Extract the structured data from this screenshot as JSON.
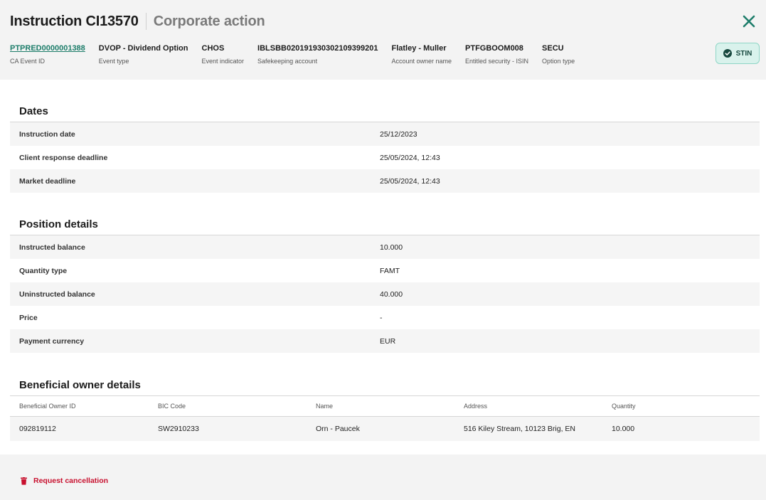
{
  "header": {
    "title": "Instruction CI13570",
    "subtitle": "Corporate action",
    "meta": [
      {
        "value": "PTPRED0000001388",
        "label": "CA Event ID",
        "link": true
      },
      {
        "value": "DVOP - Dividend Option",
        "label": "Event type"
      },
      {
        "value": "CHOS",
        "label": "Event indicator"
      },
      {
        "value": "IBLSBB020191930302109399201",
        "label": "Safekeeping account"
      },
      {
        "value": "Flatley - Muller",
        "label": "Account owner name"
      },
      {
        "value": "PTFGBOOM008",
        "label": "Entitled security - ISIN"
      },
      {
        "value": "SECU",
        "label": "Option type"
      }
    ],
    "status": "STIN"
  },
  "dates": {
    "title": "Dates",
    "rows": [
      {
        "key": "Instruction date",
        "value": "25/12/2023"
      },
      {
        "key": "Client response deadline",
        "value": "25/05/2024, 12:43"
      },
      {
        "key": "Market deadline",
        "value": "25/05/2024, 12:43"
      }
    ]
  },
  "position": {
    "title": "Position details",
    "rows": [
      {
        "key": "Instructed balance",
        "value": "10.000"
      },
      {
        "key": "Quantity type",
        "value": "FAMT"
      },
      {
        "key": "Uninstructed balance",
        "value": "40.000"
      },
      {
        "key": "Price",
        "value": "-"
      },
      {
        "key": "Payment currency",
        "value": "EUR"
      }
    ]
  },
  "beneficial": {
    "title": "Beneficial owner details",
    "headers": [
      "Beneficial Owner ID",
      "BIC Code",
      "Name",
      "Address",
      "Quantity"
    ],
    "rows": [
      [
        "092819112",
        "SW2910233",
        "Orn - Paucek",
        "516 Kiley Stream, 10123 Brig, EN",
        "10.000"
      ]
    ]
  },
  "footer": {
    "cancel_label": "Request cancellation"
  },
  "colors": {
    "accent": "#1d7d6a",
    "status_bg": "#d9f2ec",
    "danger": "#c8102e"
  }
}
